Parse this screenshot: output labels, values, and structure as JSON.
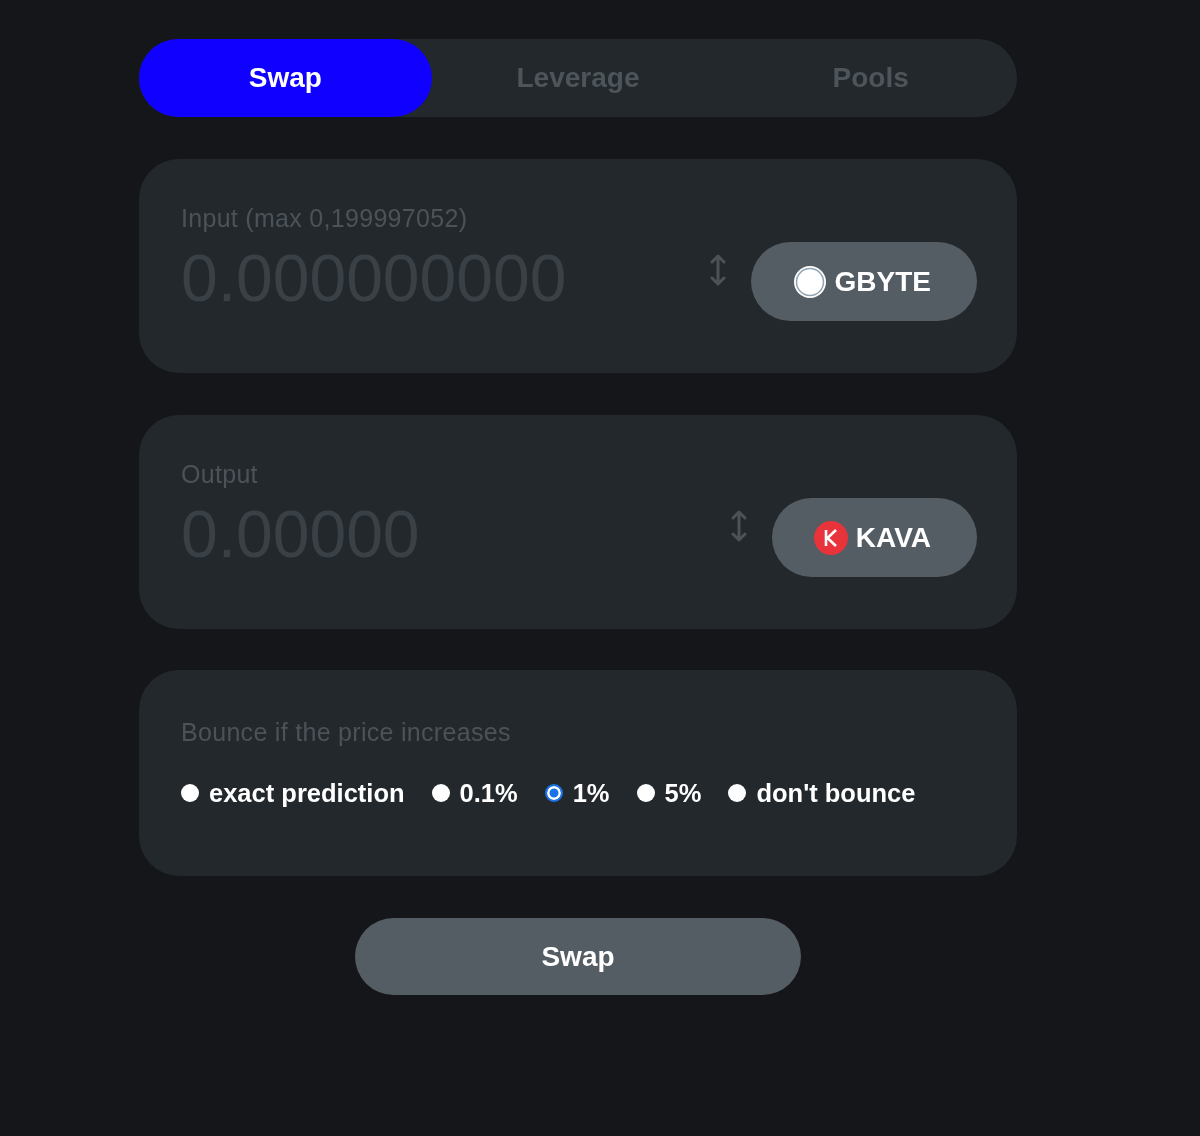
{
  "tabs": [
    {
      "label": "Swap",
      "selected": true
    },
    {
      "label": "Leverage",
      "selected": false
    },
    {
      "label": "Pools",
      "selected": false
    }
  ],
  "input": {
    "label": "Input (max 0,199997052)",
    "placeholder": "0.000000000",
    "token": {
      "label": "GBYTE",
      "kind": "ring"
    }
  },
  "output": {
    "label": "Output",
    "placeholder": "0.00000",
    "token": {
      "label": "KAVA",
      "kind": "k"
    }
  },
  "slippage": {
    "label": "Bounce if the price increases",
    "options": [
      {
        "label": "exact prediction",
        "selected": false
      },
      {
        "label": "0.1%",
        "selected": false
      },
      {
        "label": "1%",
        "selected": true
      },
      {
        "label": "5%",
        "selected": false
      },
      {
        "label": "don't bounce",
        "selected": false
      }
    ]
  },
  "submit": {
    "label": "Swap"
  }
}
